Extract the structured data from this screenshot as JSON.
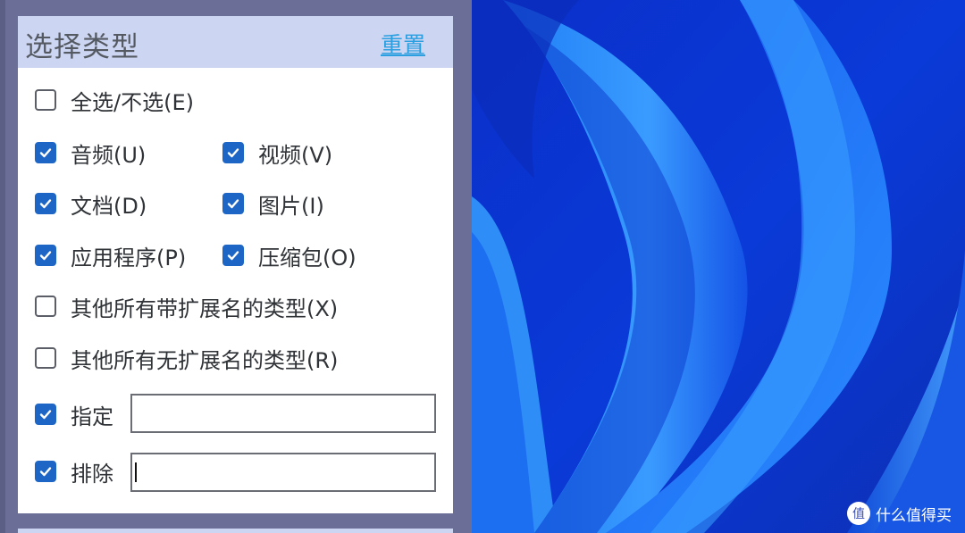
{
  "panel": {
    "title": "选择类型",
    "reset_label": "重置"
  },
  "options": {
    "select_all": {
      "label": "全选/不选(E)",
      "checked": false
    },
    "audio": {
      "label": "音频(U)",
      "checked": true
    },
    "video": {
      "label": "视频(V)",
      "checked": true
    },
    "document": {
      "label": "文档(D)",
      "checked": true
    },
    "picture": {
      "label": "图片(I)",
      "checked": true
    },
    "application": {
      "label": "应用程序(P)",
      "checked": true
    },
    "archive": {
      "label": "压缩包(O)",
      "checked": true
    },
    "other_with_ext": {
      "label": "其他所有带扩展名的类型(X)",
      "checked": false
    },
    "other_without_ext": {
      "label": "其他所有无扩展名的类型(R)",
      "checked": false
    },
    "specify": {
      "label": "指定",
      "checked": true,
      "value": ""
    },
    "exclude": {
      "label": "排除",
      "checked": true,
      "value": ""
    }
  },
  "watermark": {
    "logo_icon": "zhi-icon",
    "text": "什么值得买"
  },
  "colors": {
    "accent": "#1e66c6",
    "link": "#2b9fe0",
    "header_bg": "#ccd6f3",
    "frame_bg": "#6b6f97"
  }
}
